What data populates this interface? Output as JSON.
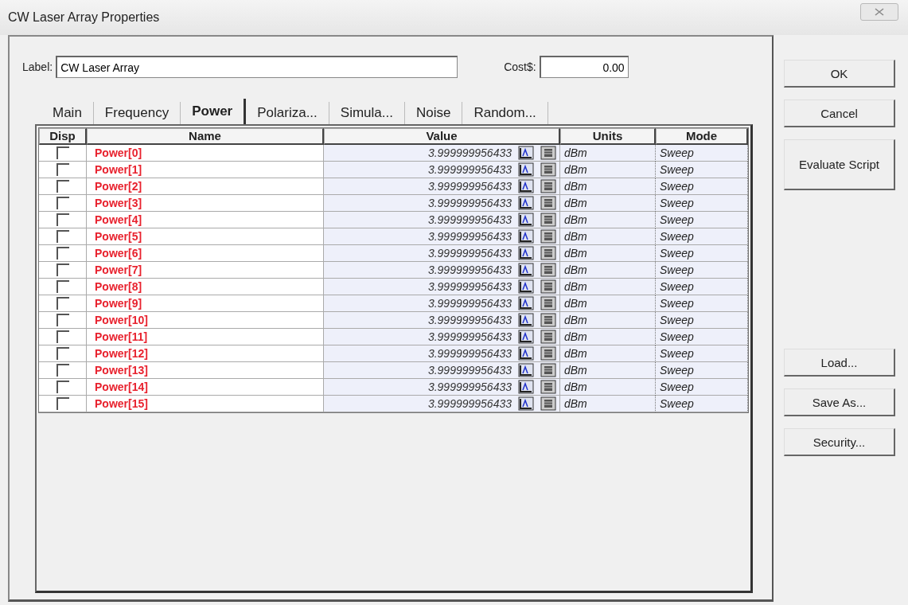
{
  "window": {
    "title": "CW Laser Array Properties"
  },
  "label_field": {
    "label": "Label:",
    "value": "CW Laser Array"
  },
  "cost_field": {
    "label": "Cost$:",
    "value": "0.00"
  },
  "tabs": [
    {
      "label": "Main",
      "selected": false
    },
    {
      "label": "Frequency",
      "selected": false
    },
    {
      "label": "Power",
      "selected": true
    },
    {
      "label": "Polariza...",
      "selected": false
    },
    {
      "label": "Simula...",
      "selected": false
    },
    {
      "label": "Noise",
      "selected": false
    },
    {
      "label": "Random...",
      "selected": false
    }
  ],
  "table": {
    "columns": [
      "Disp",
      "Name",
      "Value",
      "Units",
      "Mode"
    ],
    "rows": [
      {
        "checked": false,
        "name": "Power[0]",
        "value": "3.999999956433",
        "units": "dBm",
        "mode": "Sweep"
      },
      {
        "checked": false,
        "name": "Power[1]",
        "value": "3.999999956433",
        "units": "dBm",
        "mode": "Sweep"
      },
      {
        "checked": false,
        "name": "Power[2]",
        "value": "3.999999956433",
        "units": "dBm",
        "mode": "Sweep"
      },
      {
        "checked": false,
        "name": "Power[3]",
        "value": "3.999999956433",
        "units": "dBm",
        "mode": "Sweep"
      },
      {
        "checked": false,
        "name": "Power[4]",
        "value": "3.999999956433",
        "units": "dBm",
        "mode": "Sweep"
      },
      {
        "checked": false,
        "name": "Power[5]",
        "value": "3.999999956433",
        "units": "dBm",
        "mode": "Sweep"
      },
      {
        "checked": false,
        "name": "Power[6]",
        "value": "3.999999956433",
        "units": "dBm",
        "mode": "Sweep"
      },
      {
        "checked": false,
        "name": "Power[7]",
        "value": "3.999999956433",
        "units": "dBm",
        "mode": "Sweep"
      },
      {
        "checked": false,
        "name": "Power[8]",
        "value": "3.999999956433",
        "units": "dBm",
        "mode": "Sweep"
      },
      {
        "checked": false,
        "name": "Power[9]",
        "value": "3.999999956433",
        "units": "dBm",
        "mode": "Sweep"
      },
      {
        "checked": false,
        "name": "Power[10]",
        "value": "3.999999956433",
        "units": "dBm",
        "mode": "Sweep"
      },
      {
        "checked": false,
        "name": "Power[11]",
        "value": "3.999999956433",
        "units": "dBm",
        "mode": "Sweep"
      },
      {
        "checked": false,
        "name": "Power[12]",
        "value": "3.999999956433",
        "units": "dBm",
        "mode": "Sweep"
      },
      {
        "checked": false,
        "name": "Power[13]",
        "value": "3.999999956433",
        "units": "dBm",
        "mode": "Sweep"
      },
      {
        "checked": false,
        "name": "Power[14]",
        "value": "3.999999956433",
        "units": "dBm",
        "mode": "Sweep"
      },
      {
        "checked": false,
        "name": "Power[15]",
        "value": "3.999999956433",
        "units": "dBm",
        "mode": "Sweep"
      }
    ]
  },
  "buttons_top": [
    "OK",
    "Cancel",
    "Evaluate Script"
  ],
  "buttons_bottom": [
    "Load...",
    "Save As...",
    "Security..."
  ]
}
